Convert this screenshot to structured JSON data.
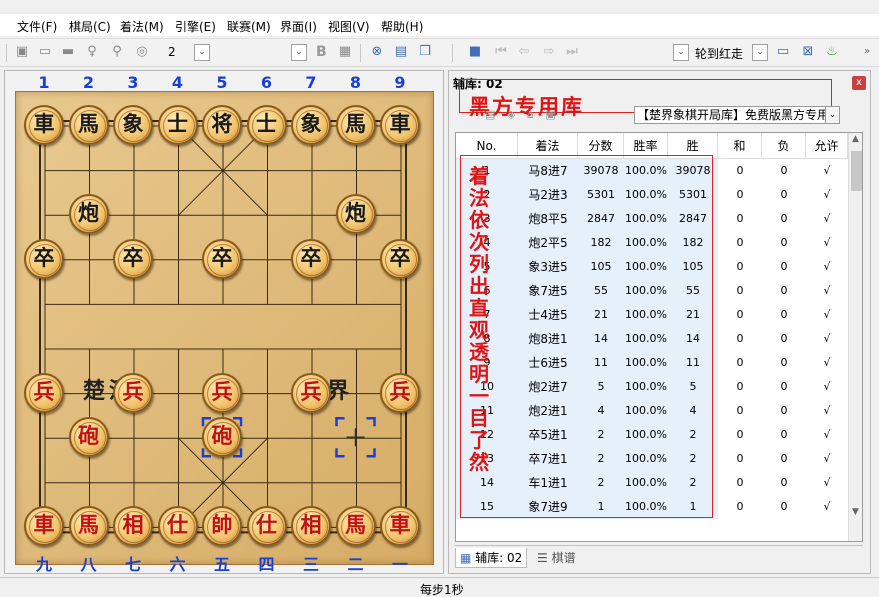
{
  "menu": [
    "文件(F)",
    "棋局(C)",
    "着法(M)",
    "引擎(E)",
    "联赛(M)",
    "界面(I)",
    "视图(V)",
    "帮助(H)"
  ],
  "toolbar": {
    "level_value": "2",
    "bold_label": "B",
    "turn_label": "轮到红走"
  },
  "board": {
    "file_numbers_top": [
      "1",
      "2",
      "3",
      "4",
      "5",
      "6",
      "7",
      "8",
      "9"
    ],
    "file_numbers_bottom": [
      "九",
      "八",
      "七",
      "六",
      "五",
      "四",
      "三",
      "二",
      "一"
    ],
    "river_left": "楚河",
    "river_right": "漢界",
    "pieces": [
      {
        "char": "車",
        "side": "black",
        "file": 0,
        "rank": 0
      },
      {
        "char": "馬",
        "side": "black",
        "file": 1,
        "rank": 0
      },
      {
        "char": "象",
        "side": "black",
        "file": 2,
        "rank": 0
      },
      {
        "char": "士",
        "side": "black",
        "file": 3,
        "rank": 0
      },
      {
        "char": "将",
        "side": "black",
        "file": 4,
        "rank": 0
      },
      {
        "char": "士",
        "side": "black",
        "file": 5,
        "rank": 0
      },
      {
        "char": "象",
        "side": "black",
        "file": 6,
        "rank": 0
      },
      {
        "char": "馬",
        "side": "black",
        "file": 7,
        "rank": 0
      },
      {
        "char": "車",
        "side": "black",
        "file": 8,
        "rank": 0
      },
      {
        "char": "炮",
        "side": "black",
        "file": 1,
        "rank": 2
      },
      {
        "char": "炮",
        "side": "black",
        "file": 7,
        "rank": 2
      },
      {
        "char": "卒",
        "side": "black",
        "file": 0,
        "rank": 3
      },
      {
        "char": "卒",
        "side": "black",
        "file": 2,
        "rank": 3
      },
      {
        "char": "卒",
        "side": "black",
        "file": 4,
        "rank": 3
      },
      {
        "char": "卒",
        "side": "black",
        "file": 6,
        "rank": 3
      },
      {
        "char": "卒",
        "side": "black",
        "file": 8,
        "rank": 3
      },
      {
        "char": "兵",
        "side": "red",
        "file": 0,
        "rank": 6
      },
      {
        "char": "兵",
        "side": "red",
        "file": 2,
        "rank": 6
      },
      {
        "char": "兵",
        "side": "red",
        "file": 4,
        "rank": 6
      },
      {
        "char": "兵",
        "side": "red",
        "file": 6,
        "rank": 6
      },
      {
        "char": "兵",
        "side": "red",
        "file": 8,
        "rank": 6
      },
      {
        "char": "砲",
        "side": "red",
        "file": 1,
        "rank": 7
      },
      {
        "char": "砲",
        "side": "red",
        "file": 4,
        "rank": 7
      },
      {
        "char": "車",
        "side": "red",
        "file": 0,
        "rank": 9
      },
      {
        "char": "馬",
        "side": "red",
        "file": 1,
        "rank": 9
      },
      {
        "char": "相",
        "side": "red",
        "file": 2,
        "rank": 9
      },
      {
        "char": "仕",
        "side": "red",
        "file": 3,
        "rank": 9
      },
      {
        "char": "帥",
        "side": "red",
        "file": 4,
        "rank": 9
      },
      {
        "char": "仕",
        "side": "red",
        "file": 5,
        "rank": 9
      },
      {
        "char": "相",
        "side": "red",
        "file": 6,
        "rank": 9
      },
      {
        "char": "馬",
        "side": "red",
        "file": 7,
        "rank": 9
      },
      {
        "char": "車",
        "side": "red",
        "file": 8,
        "rank": 9
      }
    ],
    "last_move_from": {
      "file": 7,
      "rank": 7
    },
    "last_move_to": {
      "file": 4,
      "rank": 7
    }
  },
  "book_panel": {
    "title": "辅库: 02",
    "annotation_title": "黑方专用库",
    "selected_book": "【楚界象棋开局库】免费版黑方专用...",
    "annotation_vertical": "着法依次列出直观透明一目了然",
    "columns": [
      "No.",
      "着法",
      "分数",
      "胜率",
      "胜",
      "和",
      "负",
      "允许"
    ],
    "rows": [
      [
        "1",
        "马8进7",
        "39078",
        "100.0%",
        "39078",
        "0",
        "0",
        "√"
      ],
      [
        "2",
        "马2进3",
        "5301",
        "100.0%",
        "5301",
        "0",
        "0",
        "√"
      ],
      [
        "3",
        "炮8平5",
        "2847",
        "100.0%",
        "2847",
        "0",
        "0",
        "√"
      ],
      [
        "4",
        "炮2平5",
        "182",
        "100.0%",
        "182",
        "0",
        "0",
        "√"
      ],
      [
        "5",
        "象3进5",
        "105",
        "100.0%",
        "105",
        "0",
        "0",
        "√"
      ],
      [
        "6",
        "象7进5",
        "55",
        "100.0%",
        "55",
        "0",
        "0",
        "√"
      ],
      [
        "7",
        "士4进5",
        "21",
        "100.0%",
        "21",
        "0",
        "0",
        "√"
      ],
      [
        "8",
        "炮8进1",
        "14",
        "100.0%",
        "14",
        "0",
        "0",
        "√"
      ],
      [
        "9",
        "士6进5",
        "11",
        "100.0%",
        "11",
        "0",
        "0",
        "√"
      ],
      [
        "10",
        "炮2进7",
        "5",
        "100.0%",
        "5",
        "0",
        "0",
        "√"
      ],
      [
        "11",
        "炮2进1",
        "4",
        "100.0%",
        "4",
        "0",
        "0",
        "√"
      ],
      [
        "12",
        "卒5进1",
        "2",
        "100.0%",
        "2",
        "0",
        "0",
        "√"
      ],
      [
        "13",
        "卒7进1",
        "2",
        "100.0%",
        "2",
        "0",
        "0",
        "√"
      ],
      [
        "14",
        "车1进1",
        "2",
        "100.0%",
        "2",
        "0",
        "0",
        "√"
      ],
      [
        "15",
        "象7进9",
        "1",
        "100.0%",
        "1",
        "0",
        "0",
        "√"
      ]
    ],
    "tabs": [
      "辅库: 02",
      "棋谱"
    ]
  },
  "status": {
    "text": "每步1秒"
  },
  "colors": {
    "accent_red": "#e01414",
    "file_number_blue": "#1a3fd6",
    "grid_row_highlight": "#e6f0fb"
  }
}
